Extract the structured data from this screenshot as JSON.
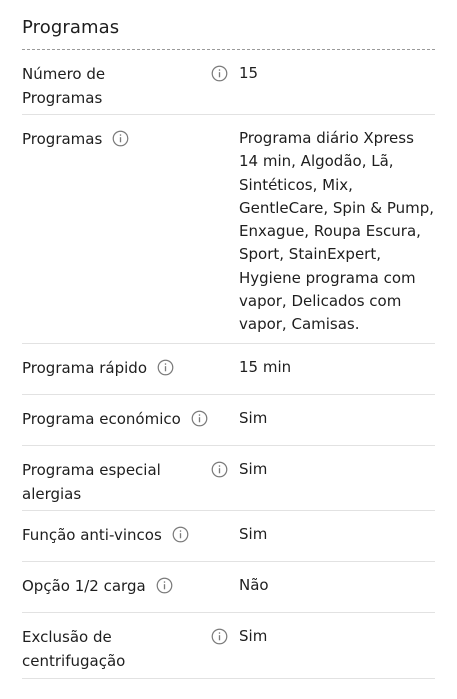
{
  "section": {
    "title": "Programas"
  },
  "icons": {
    "info": "info-circle-icon"
  },
  "rows": [
    {
      "label": "Número de Programas",
      "value": "15"
    },
    {
      "label": "Programas",
      "value": "Programa diário Xpress 14 min, Algodão, Lã, Sintéticos, Mix, GentleCare, Spin & Pump, Enxague, Roupa Escura, Sport, StainExpert, Hygiene programa com vapor, Delicados com vapor, Camisas."
    },
    {
      "label": "Programa rápido",
      "value": "15 min"
    },
    {
      "label": "Programa económico",
      "value": "Sim"
    },
    {
      "label": "Programa especial alergias",
      "value": "Sim"
    },
    {
      "label": "Função anti-vincos",
      "value": "Sim"
    },
    {
      "label": "Opção 1/2 carga",
      "value": "Não"
    },
    {
      "label": "Exclusão de centrifugação",
      "value": "Sim"
    }
  ]
}
